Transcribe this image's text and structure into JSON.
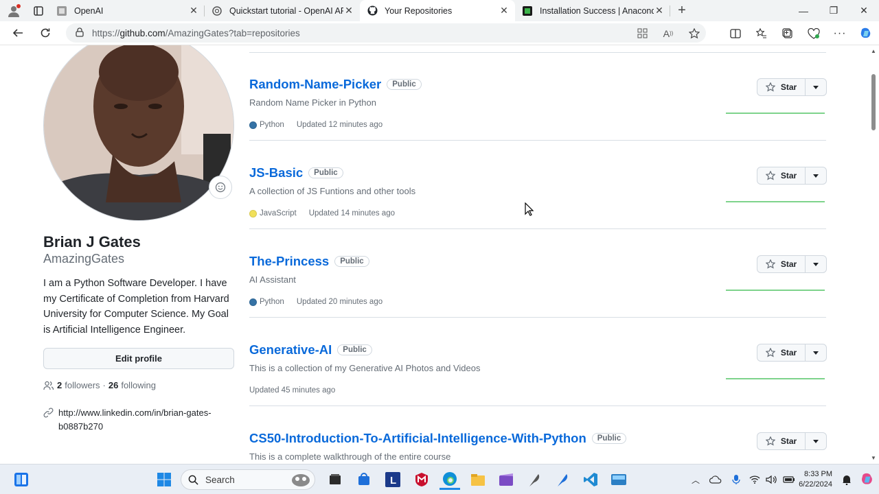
{
  "browser": {
    "tabs": [
      {
        "title": "OpenAI",
        "active": false
      },
      {
        "title": "Quickstart tutorial - OpenAI API",
        "active": false
      },
      {
        "title": "Your Repositories",
        "active": true
      },
      {
        "title": "Installation Success | Anaconda",
        "active": false
      }
    ],
    "url_prefix": "https://",
    "url_host": "github.com",
    "url_path": "/AmazingGates?tab=repositories"
  },
  "profile": {
    "full_name": "Brian J Gates",
    "username": "AmazingGates",
    "bio": "I am a Python Software Developer. I have my Certificate of Completion from Harvard University for Computer Science. My Goal is Artificial Intelligence Engineer.",
    "edit_label": "Edit profile",
    "followers_count": "2",
    "followers_label": "followers",
    "separator": "·",
    "following_count": "26",
    "following_label": "following",
    "link": "http://www.linkedin.com/in/brian-gates-b0887b270"
  },
  "repositories": [
    {
      "name": "Random-Name-Picker",
      "visibility": "Public",
      "description": "Random Name Picker in Python",
      "language": "Python",
      "language_color": "#3572A5",
      "updated": "Updated 12 minutes ago",
      "star_label": "Star"
    },
    {
      "name": "JS-Basic",
      "visibility": "Public",
      "description": "A collection of JS Funtions and other tools",
      "language": "JavaScript",
      "language_color": "#f1e05a",
      "updated": "Updated 14 minutes ago",
      "star_label": "Star"
    },
    {
      "name": "The-Princess",
      "visibility": "Public",
      "description": "AI Assistant",
      "language": "Python",
      "language_color": "#3572A5",
      "updated": "Updated 20 minutes ago",
      "star_label": "Star"
    },
    {
      "name": "Generative-AI",
      "visibility": "Public",
      "description": "This is a collection of my Generative AI Photos and Videos",
      "language": "",
      "language_color": "",
      "updated": "Updated 45 minutes ago",
      "star_label": "Star"
    },
    {
      "name": "CS50-Introduction-To-Artificial-Intelligence-With-Python",
      "visibility": "Public",
      "description": "This is a complete walkthrough of the entire course",
      "language": "",
      "language_color": "",
      "updated": "",
      "star_label": "Star"
    }
  ],
  "taskbar": {
    "search_placeholder": "Search",
    "time": "8:33 PM",
    "date": "6/22/2024"
  }
}
